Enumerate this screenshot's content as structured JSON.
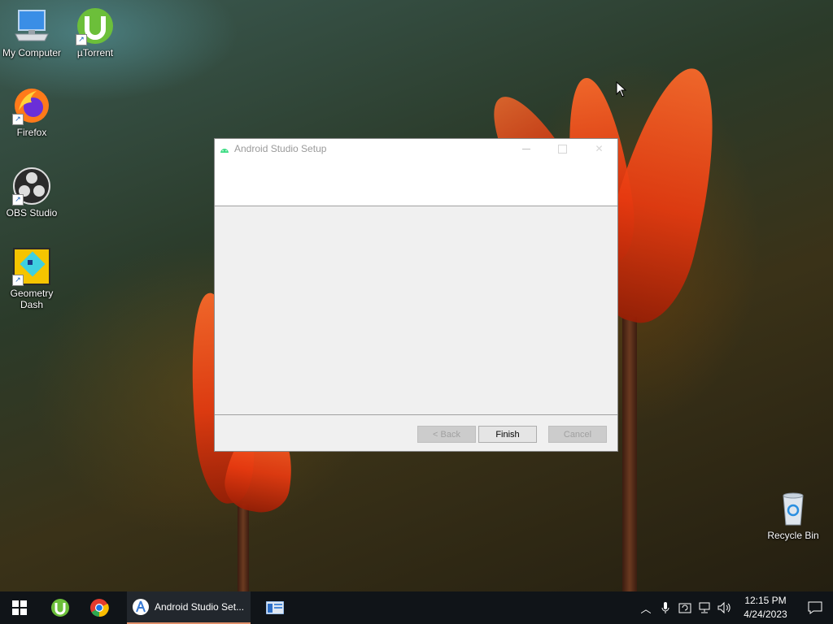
{
  "desktop": {
    "icons": [
      {
        "label": "My Computer",
        "icon": "computer-icon"
      },
      {
        "label": "µTorrent",
        "icon": "utorrent-icon"
      },
      {
        "label": "Firefox",
        "icon": "firefox-icon"
      },
      {
        "label": "OBS Studio",
        "icon": "obs-icon"
      },
      {
        "label": "Geometry Dash",
        "icon": "geometry-dash-icon"
      },
      {
        "label": "Recycle Bin",
        "icon": "recycle-bin-icon"
      }
    ]
  },
  "dialog": {
    "title": "Android Studio Setup",
    "buttons": {
      "back": "< Back",
      "finish": "Finish",
      "cancel": "Cancel"
    }
  },
  "taskbar": {
    "active_window_label": "Android Studio Set...",
    "clock": {
      "time": "12:15 PM",
      "date": "4/24/2023"
    }
  },
  "colors": {
    "accent": "#e0906a",
    "taskbar_bg": "#101418"
  }
}
